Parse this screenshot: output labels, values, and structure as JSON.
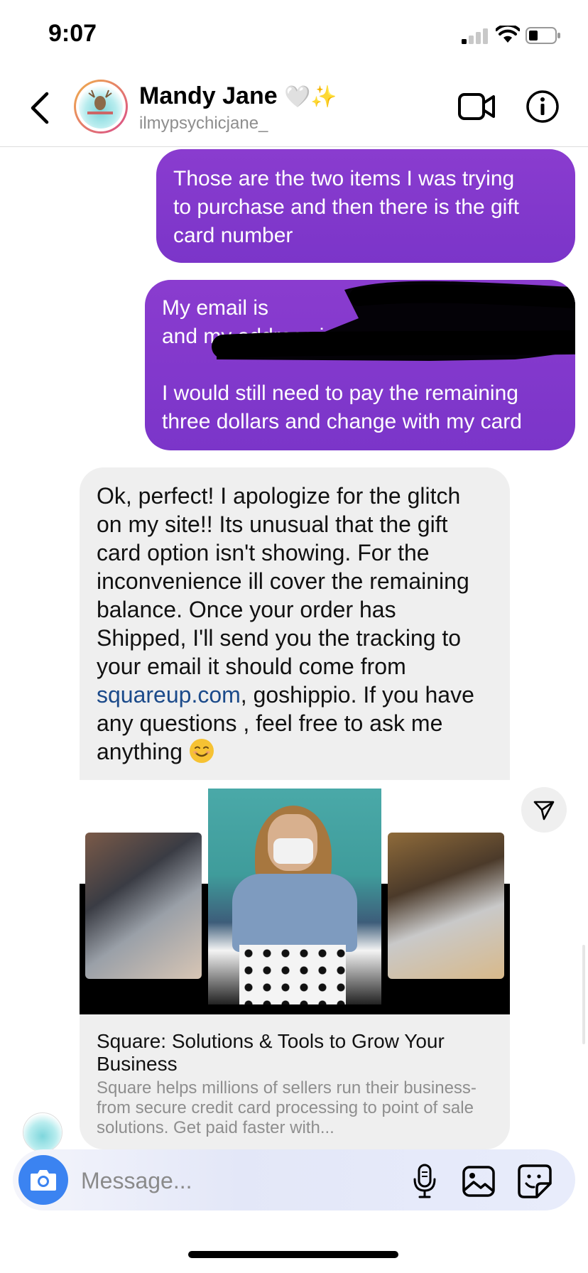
{
  "status_bar": {
    "time": "9:07"
  },
  "header": {
    "name": "Mandy Jane",
    "name_emoji": "🤍✨",
    "username": "ilmypsychicjane_"
  },
  "messages": {
    "outgoing_1": {
      "lines": [
        "Those are the two items I was trying",
        "to purchase and then there is the gift",
        "card number"
      ]
    },
    "outgoing_2": {
      "lines": [
        "My email is ",
        "and my address is ",
        "",
        "I would still need to pay the remaining",
        "three dollars and change with my card"
      ],
      "redacted": true
    },
    "incoming_1": {
      "lines": [
        "Ok, perfect! I apologize for the glitch",
        "on my site!! Its unusual that the gift",
        "card option isn't showing. For the",
        "inconvenience ill cover the remaining",
        "balance.  Once your order has",
        "Shipped, I'll send you the tracking to",
        "your email it should come from"
      ],
      "link": "squareup.com",
      "after_link": ",  goshippio. If you have",
      "line_9": "any questions ,  feel free to ask me",
      "line_10": "anything",
      "emoji": "😊"
    }
  },
  "link_card": {
    "title": "Square: Solutions & Tools to Grow Your Business",
    "description": "Square helps millions of sellers run their business-from secure credit card processing to point of sale solutions. Get paid faster with..."
  },
  "composer": {
    "placeholder": "Message..."
  },
  "colors": {
    "outgoing_bubble": "#8a3ccf",
    "incoming_bubble": "#efefef",
    "camera_button": "#3b83f1",
    "link": "#1b4a8a"
  },
  "icons": [
    "back-chevron-icon",
    "video-call-icon",
    "info-icon",
    "share-icon",
    "camera-icon",
    "microphone-icon",
    "gallery-icon",
    "sticker-icon"
  ]
}
